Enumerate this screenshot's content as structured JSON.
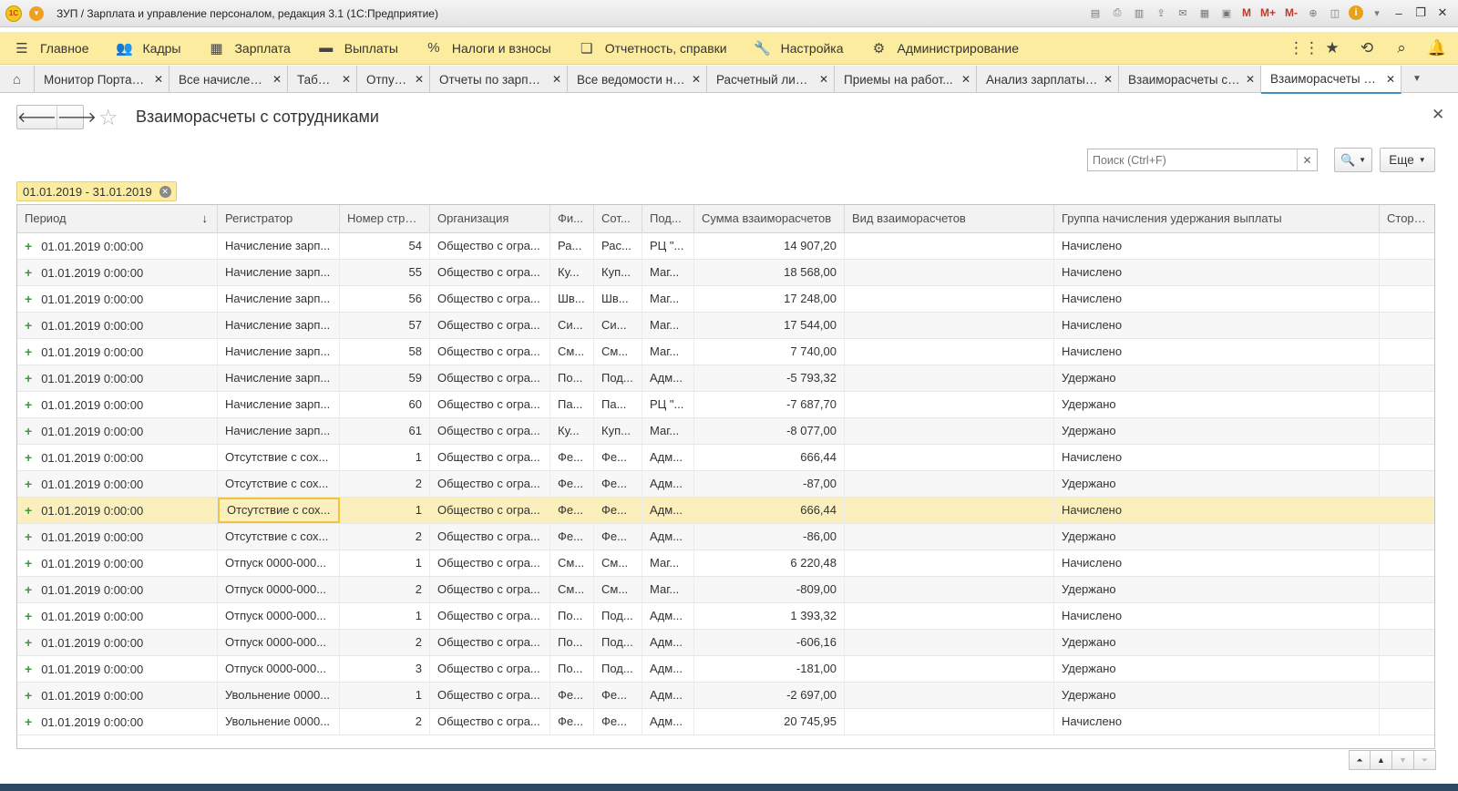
{
  "window": {
    "title": "ЗУП / Зарплата и управление персоналом, редакция 3.1  (1С:Предприятие)",
    "logo_text": "1С",
    "tools": [
      "M",
      "M+",
      "M-"
    ]
  },
  "sections": [
    {
      "label": "Главное",
      "icon": "menu-icon"
    },
    {
      "label": "Кадры",
      "icon": "people-icon"
    },
    {
      "label": "Зарплата",
      "icon": "calculator-icon"
    },
    {
      "label": "Выплаты",
      "icon": "wallet-icon"
    },
    {
      "label": "Налоги и взносы",
      "icon": "percent-icon"
    },
    {
      "label": "Отчетность, справки",
      "icon": "reports-icon"
    },
    {
      "label": "Настройка",
      "icon": "wrench-icon"
    },
    {
      "label": "Администрирование",
      "icon": "gear-icon"
    }
  ],
  "tabs": [
    {
      "label": "Монитор Портала ...",
      "width": 0
    },
    {
      "label": "Все начисления"
    },
    {
      "label": "Табели"
    },
    {
      "label": "Отпуска"
    },
    {
      "label": "Отчеты по зарплате"
    },
    {
      "label": "Все ведомости на..."
    },
    {
      "label": "Расчетный листок"
    },
    {
      "label": "Приемы на работ..."
    },
    {
      "label": "Анализ зарплаты ..."
    },
    {
      "label": "Взаиморасчеты с ..."
    },
    {
      "label": "Взаиморасчеты с ...",
      "active": true
    }
  ],
  "form": {
    "title": "Взаиморасчеты с сотрудниками",
    "search_placeholder": "Поиск (Ctrl+F)",
    "more_label": "Еще",
    "filter_period": "01.01.2019 - 31.01.2019"
  },
  "table": {
    "columns": [
      "Период",
      "Регистратор",
      "Номер строки",
      "Организация",
      "Фи...",
      "Сот...",
      "Под...",
      "Сумма взаиморасчетов",
      "Вид взаиморасчетов",
      "Группа начисления удержания выплаты",
      "Сторно"
    ],
    "rows": [
      [
        "01.01.2019 0:00:00",
        "Начисление зарп...",
        "54",
        "Общество с огра...",
        "Ра...",
        "Рас...",
        "РЦ \"...",
        "14 907,20",
        "",
        "Начислено",
        ""
      ],
      [
        "01.01.2019 0:00:00",
        "Начисление зарп...",
        "55",
        "Общество с огра...",
        "Ку...",
        "Куп...",
        "Маг...",
        "18 568,00",
        "",
        "Начислено",
        ""
      ],
      [
        "01.01.2019 0:00:00",
        "Начисление зарп...",
        "56",
        "Общество с огра...",
        "Шв...",
        "Шв...",
        "Маг...",
        "17 248,00",
        "",
        "Начислено",
        ""
      ],
      [
        "01.01.2019 0:00:00",
        "Начисление зарп...",
        "57",
        "Общество с огра...",
        "Си...",
        "Си...",
        "Маг...",
        "17 544,00",
        "",
        "Начислено",
        ""
      ],
      [
        "01.01.2019 0:00:00",
        "Начисление зарп...",
        "58",
        "Общество с огра...",
        "См...",
        "См...",
        "Маг...",
        "7 740,00",
        "",
        "Начислено",
        ""
      ],
      [
        "01.01.2019 0:00:00",
        "Начисление зарп...",
        "59",
        "Общество с огра...",
        "По...",
        "Под...",
        "Адм...",
        "-5 793,32",
        "",
        "Удержано",
        ""
      ],
      [
        "01.01.2019 0:00:00",
        "Начисление зарп...",
        "60",
        "Общество с огра...",
        "Па...",
        "Па...",
        "РЦ \"...",
        "-7 687,70",
        "",
        "Удержано",
        ""
      ],
      [
        "01.01.2019 0:00:00",
        "Начисление зарп...",
        "61",
        "Общество с огра...",
        "Ку...",
        "Куп...",
        "Маг...",
        "-8 077,00",
        "",
        "Удержано",
        ""
      ],
      [
        "01.01.2019 0:00:00",
        "Отсутствие с сох...",
        "1",
        "Общество с огра...",
        "Фе...",
        "Фе...",
        "Адм...",
        "666,44",
        "",
        "Начислено",
        ""
      ],
      [
        "01.01.2019 0:00:00",
        "Отсутствие с сох...",
        "2",
        "Общество с огра...",
        "Фе...",
        "Фе...",
        "Адм...",
        "-87,00",
        "",
        "Удержано",
        ""
      ],
      [
        "01.01.2019 0:00:00",
        "Отсутствие с сох...",
        "1",
        "Общество с огра...",
        "Фе...",
        "Фе...",
        "Адм...",
        "666,44",
        "",
        "Начислено",
        ""
      ],
      [
        "01.01.2019 0:00:00",
        "Отсутствие с сох...",
        "2",
        "Общество с огра...",
        "Фе...",
        "Фе...",
        "Адм...",
        "-86,00",
        "",
        "Удержано",
        ""
      ],
      [
        "01.01.2019 0:00:00",
        "Отпуск 0000-000...",
        "1",
        "Общество с огра...",
        "См...",
        "См...",
        "Маг...",
        "6 220,48",
        "",
        "Начислено",
        ""
      ],
      [
        "01.01.2019 0:00:00",
        "Отпуск 0000-000...",
        "2",
        "Общество с огра...",
        "См...",
        "См...",
        "Маг...",
        "-809,00",
        "",
        "Удержано",
        ""
      ],
      [
        "01.01.2019 0:00:00",
        "Отпуск 0000-000...",
        "1",
        "Общество с огра...",
        "По...",
        "Под...",
        "Адм...",
        "1 393,32",
        "",
        "Начислено",
        ""
      ],
      [
        "01.01.2019 0:00:00",
        "Отпуск 0000-000...",
        "2",
        "Общество с огра...",
        "По...",
        "Под...",
        "Адм...",
        "-606,16",
        "",
        "Удержано",
        ""
      ],
      [
        "01.01.2019 0:00:00",
        "Отпуск 0000-000...",
        "3",
        "Общество с огра...",
        "По...",
        "Под...",
        "Адм...",
        "-181,00",
        "",
        "Удержано",
        ""
      ],
      [
        "01.01.2019 0:00:00",
        "Увольнение 0000...",
        "1",
        "Общество с огра...",
        "Фе...",
        "Фе...",
        "Адм...",
        "-2 697,00",
        "",
        "Удержано",
        ""
      ],
      [
        "01.01.2019 0:00:00",
        "Увольнение 0000...",
        "2",
        "Общество с огра...",
        "Фе...",
        "Фе...",
        "Адм...",
        "20 745,95",
        "",
        "Начислено",
        ""
      ]
    ],
    "selected_row": 10
  },
  "colors": {
    "sections_bar": "#fbec9f",
    "selected_row": "#fbefbe",
    "active_tab_accent": "#3f8ec5",
    "focus_border": "#f0c53a"
  }
}
